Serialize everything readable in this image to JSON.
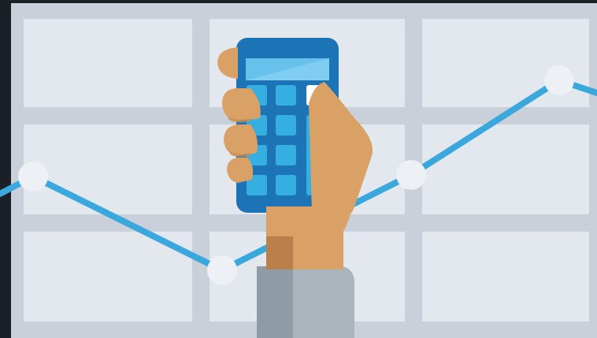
{
  "illustration": {
    "subject": "hand-holding-calculator-over-line-graph",
    "colors": {
      "frame": "#1b1f26",
      "grid_lines": "#c9d0d9",
      "grid_cells": "#e3e8ef",
      "trend_line": "#3aa8dc",
      "trend_points": "#edf1f5",
      "calculator_body": "#1c74b7",
      "calculator_screen": "#67c1ec",
      "calculator_keys": "#35aee2",
      "skin": "#d9a166",
      "skin_shadow": "#b9804b",
      "sleeve": "#a9b4bd",
      "sleeve_shadow": "#8f9ba5"
    },
    "icons": [
      "calculator-icon",
      "hand-icon",
      "line-graph-icon"
    ]
  }
}
